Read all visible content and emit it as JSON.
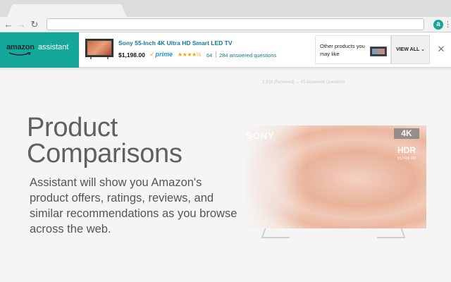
{
  "browser": {
    "back_label": "←",
    "forward_label": "→",
    "reload_label": "↻",
    "extension_icon": "a",
    "menu_icon": "⋮"
  },
  "assistant": {
    "logo_amazon": "amazon",
    "logo_assistant": "assistant",
    "brand_color": "#15a799",
    "product": {
      "title": "Sony 55-Inch 4K Ultra HD Smart LED TV",
      "price": "$1,198.00",
      "prime_label": "prime",
      "stars_glyph": "★★★★½",
      "rating_count": "64",
      "answered_questions": "284 answered questions"
    },
    "other_products_text": "Other products you may like",
    "view_all_label": "VIEW ALL ⌄",
    "close_label": "✕"
  },
  "background_page": {
    "faded_line": "1,918 (Renewed) ⌄    45 Answered Questions"
  },
  "hero": {
    "title": "Product Comparisons",
    "description": "Assistant will show you Amazon's product offers, ratings, reviews, and similar recommendations as you browse across the web."
  },
  "tv": {
    "brand": "SONY",
    "badge_4k": "4K",
    "badge_hdr": "HDR",
    "badge_ultra": "ULTRA HD"
  }
}
